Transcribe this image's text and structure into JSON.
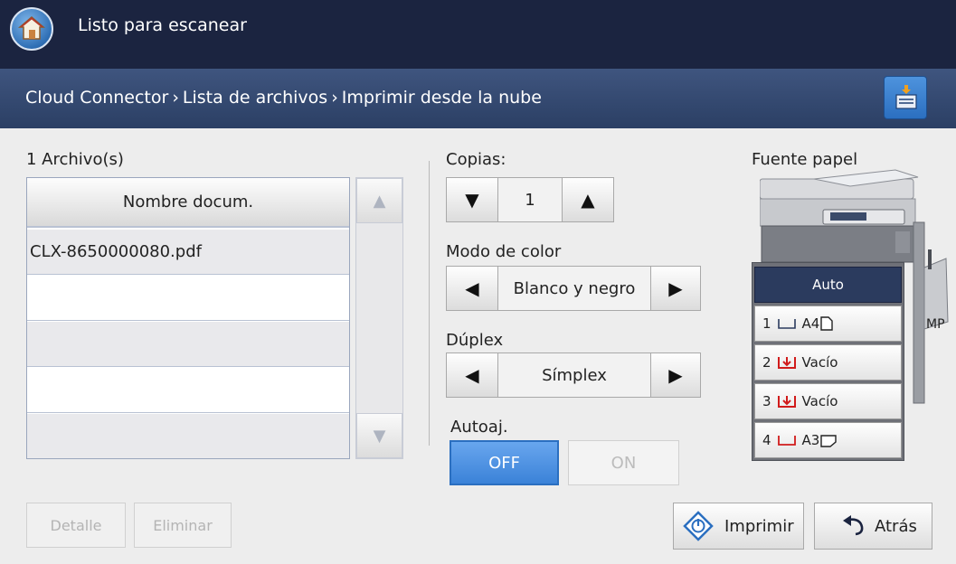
{
  "header": {
    "title": "Listo para escanear"
  },
  "breadcrumb": {
    "items": [
      "Cloud Connector",
      "Lista de archivos",
      "Imprimir desde la nube"
    ]
  },
  "file_list": {
    "count_label": "1  Archivo(s)",
    "column_header": "Nombre docum.",
    "rows": [
      "CLX-8650000080.pdf",
      "",
      "",
      "",
      ""
    ]
  },
  "copies": {
    "label": "Copias:",
    "value": "1"
  },
  "color_mode": {
    "label": "Modo de color",
    "value": "Blanco y negro"
  },
  "duplex": {
    "label": "Dúplex",
    "value": "Símplex"
  },
  "autofit": {
    "label": "Autoaj.",
    "off_label": "OFF",
    "on_label": "ON",
    "selected": "OFF"
  },
  "paper_source": {
    "label": "Fuente papel",
    "auto_label": "Auto",
    "mp_label": "MP",
    "trays": [
      {
        "num": "1",
        "status": "A4",
        "status_color": "#2b3b5e"
      },
      {
        "num": "2",
        "status": "Vacío",
        "status_color": "#d11b1b"
      },
      {
        "num": "3",
        "status": "Vacío",
        "status_color": "#d11b1b"
      },
      {
        "num": "4",
        "status": "A3",
        "status_color": "#d11b1b"
      }
    ]
  },
  "buttons": {
    "detail": "Detalle",
    "delete": "Eliminar",
    "print": "Imprimir",
    "back": "Atrás"
  },
  "colors": {
    "accent": "#3b82d8",
    "header_bg": "#1b2440",
    "breadcrumb_bg": "#2b3f64"
  },
  "icons": {
    "home": "home-icon",
    "job_queue": "job-queue-icon",
    "print": "print-start-icon",
    "back": "back-arrow-icon"
  }
}
